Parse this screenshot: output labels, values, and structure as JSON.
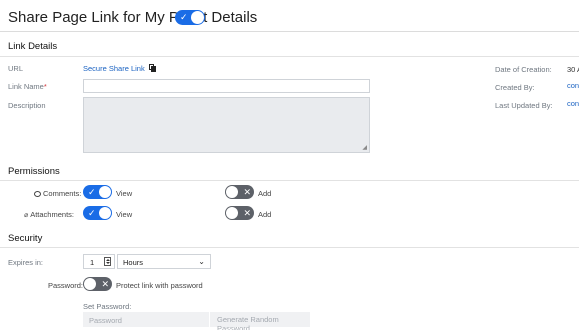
{
  "header": {
    "title": "Share Page Link for My Prject Details",
    "toggle_on": true
  },
  "link_details": {
    "section_title": "Link Details",
    "url_label": "URL",
    "url_link": "Secure Share Link",
    "link_name_label": "Link Name",
    "link_name_required": "*",
    "link_name_value": "",
    "description_label": "Description",
    "description_value": "",
    "meta": {
      "date_label": "Date of Creation:",
      "date_value": "30 A",
      "created_by_label": "Created By:",
      "created_by_value": "con",
      "last_updated_label": "Last Updated By:",
      "last_updated_value": "con"
    }
  },
  "permissions": {
    "section_title": "Permissions",
    "comments_label": "Comments:",
    "comments_view_label": "View",
    "comments_view_on": true,
    "comments_add_label": "Add",
    "comments_add_on": false,
    "attachments_label": "Attachments:",
    "attachments_view_label": "View",
    "attachments_view_on": true,
    "attachments_add_label": "Add",
    "attachments_add_on": false
  },
  "security": {
    "section_title": "Security",
    "expires_label": "Expires in:",
    "expires_value": "1",
    "expires_unit": "Hours",
    "password_label": "Password:",
    "password_toggle_label": "Protect link with password",
    "password_toggle_on": false,
    "set_password_label": "Set Password:",
    "password_placeholder": "Password",
    "generate_button": "Generate Random Password"
  },
  "colors": {
    "accent": "#1a6ce6",
    "toggle_off": "#5d6168",
    "link": "#1b63c2"
  }
}
